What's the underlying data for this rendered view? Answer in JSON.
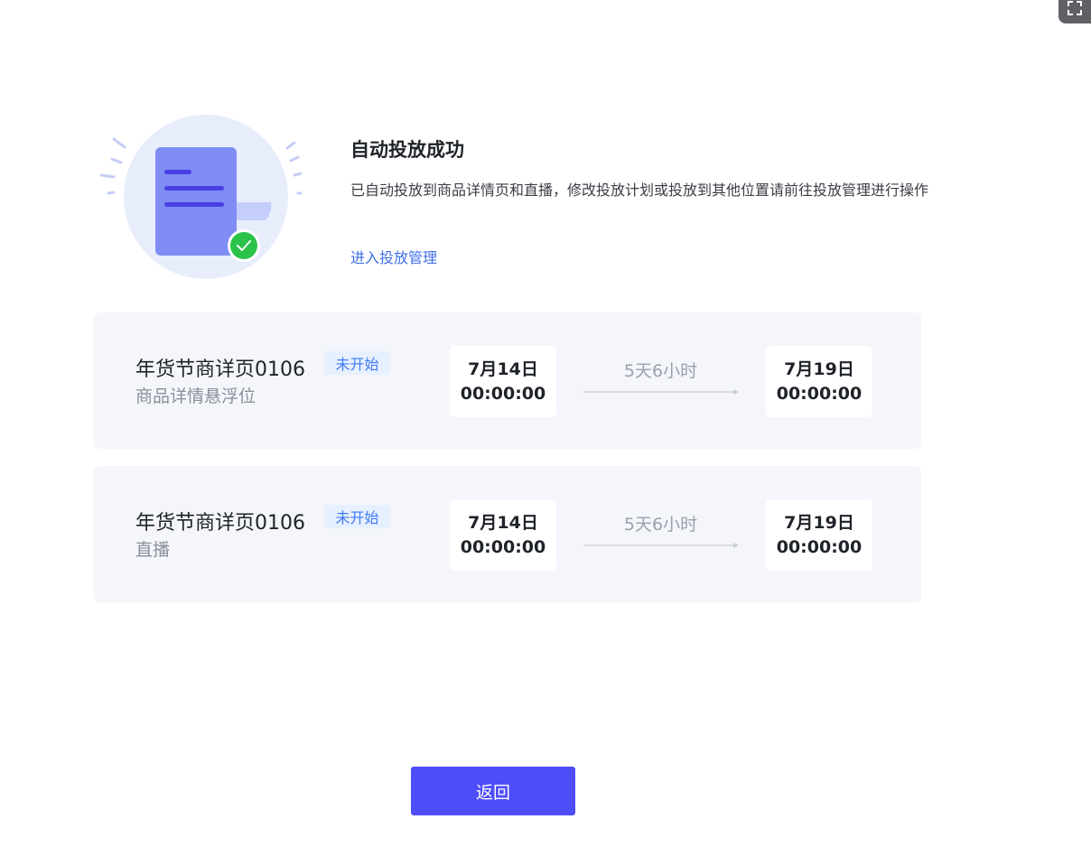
{
  "success": {
    "title": "自动投放成功",
    "description": "已自动投放到商品详情页和直播，修改投放计划或投放到其他位置请前往投放管理进行操作",
    "manage_link": "进入投放管理"
  },
  "plans": [
    {
      "name": "年货节商详页0106",
      "status": "未开始",
      "position": "商品详情悬浮位",
      "start_date": "7月14日",
      "start_time": "00:00:00",
      "duration": "5天6小时",
      "end_date": "7月19日",
      "end_time": "00:00:00"
    },
    {
      "name": "年货节商详页0106",
      "status": "未开始",
      "position": "直播",
      "start_date": "7月14日",
      "start_time": "00:00:00",
      "duration": "5天6小时",
      "end_date": "7月19日",
      "end_time": "00:00:00"
    }
  ],
  "footer": {
    "back_label": "返回"
  },
  "icons": {
    "corner": "fullscreen-icon",
    "illustration": "document-success-illustration",
    "check": "check-icon",
    "arrow": "arrow-right-icon"
  },
  "colors": {
    "primary": "#4d4dfa",
    "link": "#3e6fe9",
    "success": "#2bc24a",
    "badge_bg": "#e7f0ff",
    "badge_text": "#3f7bf4",
    "card_bg": "#f4f6fb"
  }
}
